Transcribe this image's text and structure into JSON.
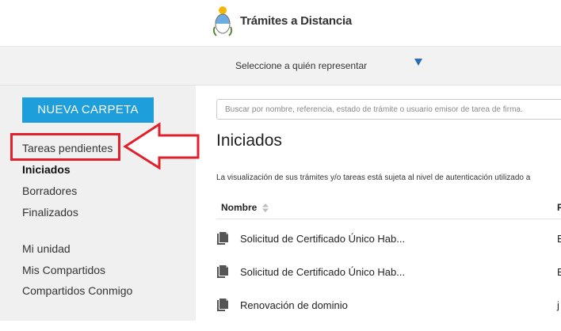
{
  "header": {
    "title": "Trámites a Distancia"
  },
  "selector": {
    "label": "Seleccione a quién representar"
  },
  "sidebar": {
    "new_folder": "NUEVA CARPETA",
    "items": [
      {
        "label": "Tareas pendientes"
      },
      {
        "label": "Iniciados"
      },
      {
        "label": "Borradores"
      },
      {
        "label": "Finalizados"
      },
      {
        "label": "Mi unidad"
      },
      {
        "label": "Mis Compartidos"
      },
      {
        "label": "Compartidos Conmigo"
      }
    ]
  },
  "main": {
    "search_placeholder": "Buscar por nombre, referencia, estado de trámite o usuario emisor de tarea de firma.",
    "title": "Iniciados",
    "notice": "La visualización de sus trámites y/o tareas está sujeta al nivel de autenticación utilizado a",
    "columns": [
      "Nombre",
      "F"
    ],
    "rows": [
      {
        "name": "Solicitud de Certificado Único Hab...",
        "extra": "E"
      },
      {
        "name": "Solicitud de Certificado Único Hab...",
        "extra": "E"
      },
      {
        "name": "Renovación de dominio",
        "extra": "j"
      }
    ]
  },
  "colors": {
    "accent": "#1e9fdc",
    "annotation": "#e0202a"
  }
}
